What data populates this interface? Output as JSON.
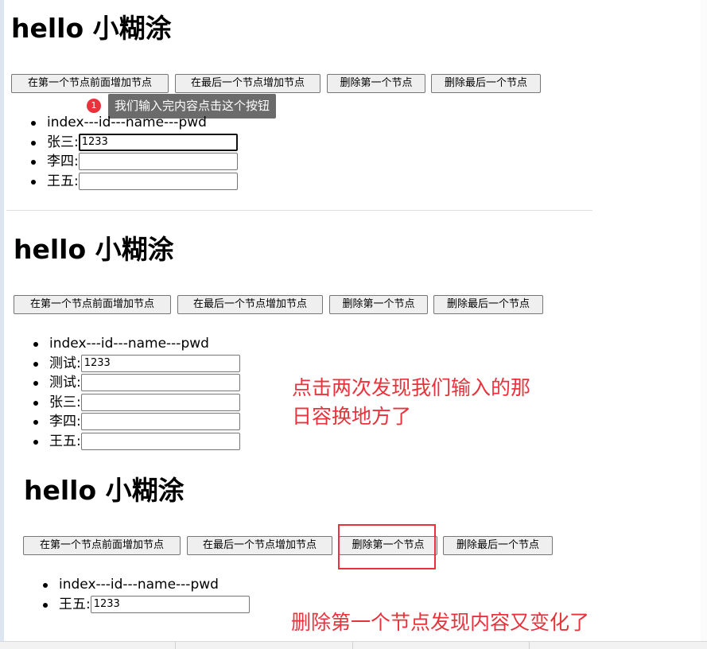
{
  "panels": [
    {
      "title": "hello 小糊涂",
      "buttons": [
        "在第一个节点前面增加节点",
        "在最后一个节点增加节点",
        "删除第一个节点",
        "删除最后一个节点"
      ],
      "header_row": "index---id---name---pwd",
      "rows": [
        {
          "label": "张三:",
          "value": "1233"
        },
        {
          "label": "李四:",
          "value": ""
        },
        {
          "label": "王五:",
          "value": ""
        }
      ]
    },
    {
      "title": "hello 小糊涂",
      "buttons": [
        "在第一个节点前面增加节点",
        "在最后一个节点增加节点",
        "删除第一个节点",
        "删除最后一个节点"
      ],
      "header_row": "index---id---name---pwd",
      "rows": [
        {
          "label": "测试:",
          "value": "1233"
        },
        {
          "label": "测试:",
          "value": ""
        },
        {
          "label": "张三:",
          "value": ""
        },
        {
          "label": "李四:",
          "value": ""
        },
        {
          "label": "王五:",
          "value": ""
        }
      ]
    },
    {
      "title": "hello 小糊涂",
      "buttons": [
        "在第一个节点前面增加节点",
        "在最后一个节点增加节点",
        "删除第一个节点",
        "删除最后一个节点"
      ],
      "header_row": "index---id---name---pwd",
      "rows": [
        {
          "label": "王五:",
          "value": "1233"
        }
      ]
    }
  ],
  "tooltip": {
    "badge": "1",
    "text": "我们输入完内容点击这个按钮"
  },
  "annotations": {
    "second_line1": "点击两次发现我们输入的那",
    "second_line2": "日容换地方了",
    "third": "删除第一个节点发现内容又变化了"
  },
  "colors": {
    "annotation": "#e8333c",
    "tooltip_bg": "#6b6b6b"
  }
}
